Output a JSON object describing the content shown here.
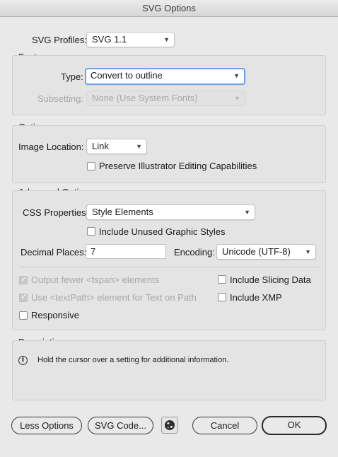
{
  "window": {
    "title": "SVG Options"
  },
  "profiles": {
    "label": "SVG Profiles:",
    "value": "SVG 1.1"
  },
  "fonts": {
    "title": "Fonts",
    "type_label": "Type:",
    "type_value": "Convert to outline",
    "subsetting_label": "Subsetting:",
    "subsetting_value": "None (Use System Fonts)"
  },
  "options": {
    "title": "Options",
    "image_location_label": "Image Location:",
    "image_location_value": "Link",
    "preserve_label": "Preserve Illustrator Editing Capabilities",
    "preserve_checked": false
  },
  "advanced": {
    "title": "Advanced Options",
    "css_label": "CSS Properties:",
    "css_value": "Style Elements",
    "unused_styles_label": "Include Unused Graphic Styles",
    "decimal_label": "Decimal Places:",
    "decimal_value": "7",
    "encoding_label": "Encoding:",
    "encoding_value": "Unicode (UTF-8)",
    "tspan_label": "Output fewer <tspan> elements",
    "textpath_label": "Use <textPath> element for Text on Path",
    "responsive_label": "Responsive",
    "slicing_label": "Include Slicing Data",
    "xmp_label": "Include XMP"
  },
  "description": {
    "title": "Description",
    "text": "Hold the cursor over a setting for additional information."
  },
  "buttons": {
    "less_options": "Less Options",
    "svg_code": "SVG Code...",
    "cancel": "Cancel",
    "ok": "OK"
  }
}
